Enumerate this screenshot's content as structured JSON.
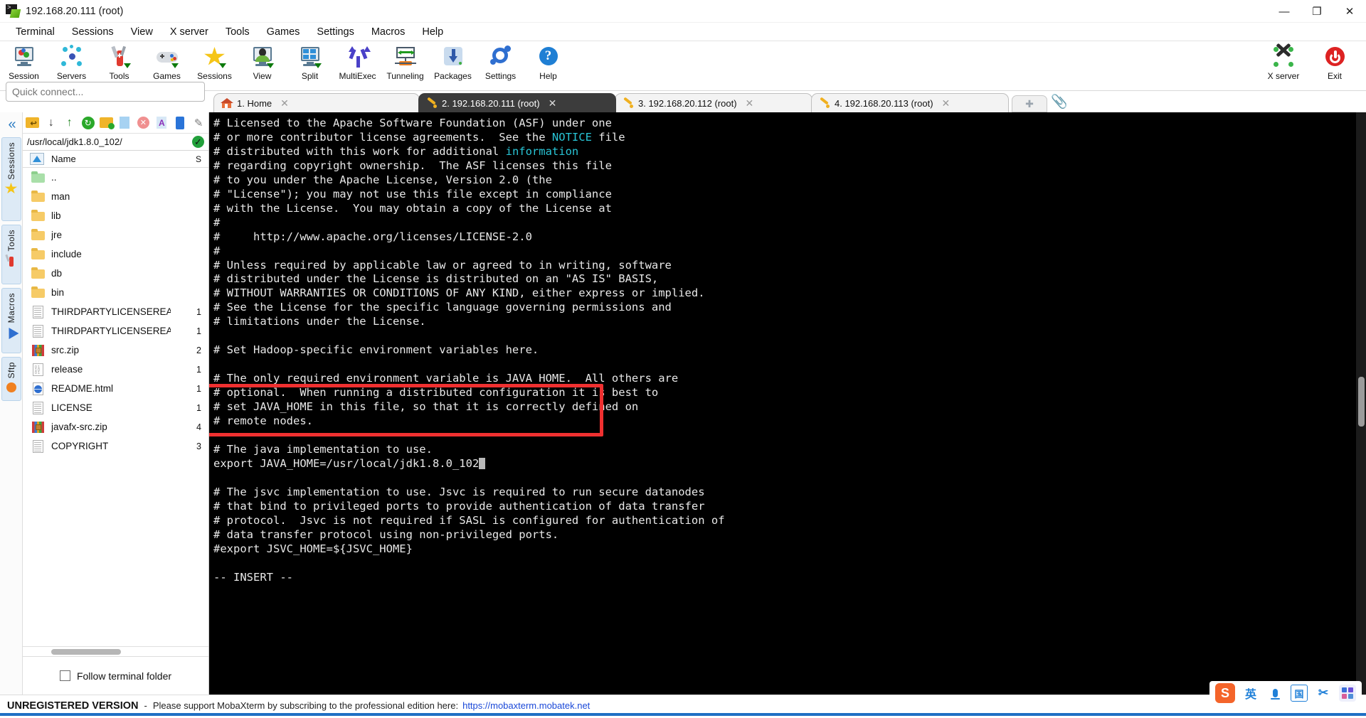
{
  "window": {
    "title": "192.168.20.111 (root)",
    "icon": "mobaxterm-icon",
    "minimize": "—",
    "maximize": "❐",
    "close": "✕"
  },
  "menubar": {
    "items": [
      {
        "label": "Terminal",
        "name": "menu-terminal"
      },
      {
        "label": "Sessions",
        "name": "menu-sessions"
      },
      {
        "label": "View",
        "name": "menu-view"
      },
      {
        "label": "X server",
        "name": "menu-xserver"
      },
      {
        "label": "Tools",
        "name": "menu-tools"
      },
      {
        "label": "Games",
        "name": "menu-games"
      },
      {
        "label": "Settings",
        "name": "menu-settings"
      },
      {
        "label": "Macros",
        "name": "menu-macros"
      },
      {
        "label": "Help",
        "name": "menu-help"
      }
    ]
  },
  "ribbon": {
    "items": [
      {
        "label": "Session",
        "icon": "session-icon"
      },
      {
        "label": "Servers",
        "icon": "servers-icon"
      },
      {
        "label": "Tools",
        "icon": "tools-knife-icon"
      },
      {
        "label": "Games",
        "icon": "gamepad-icon"
      },
      {
        "label": "Sessions",
        "icon": "star-icon"
      },
      {
        "label": "View",
        "icon": "view-user-icon"
      },
      {
        "label": "Split",
        "icon": "split-grid-icon"
      },
      {
        "label": "MultiExec",
        "icon": "multiexec-fork-icon"
      },
      {
        "label": "Tunneling",
        "icon": "tunneling-icon"
      },
      {
        "label": "Packages",
        "icon": "packages-download-icon"
      },
      {
        "label": "Settings",
        "icon": "settings-gear-icon"
      },
      {
        "label": "Help",
        "icon": "help-question-icon"
      }
    ],
    "right": [
      {
        "label": "X server",
        "icon": "x-server-icon"
      },
      {
        "label": "Exit",
        "icon": "exit-power-icon"
      }
    ]
  },
  "quick_connect": {
    "placeholder": "Quick connect...",
    "value": ""
  },
  "tabs": {
    "items": [
      {
        "label": "1. Home",
        "icon": "home-icon",
        "active": false,
        "close": "✕"
      },
      {
        "label": "2. 192.168.20.111 (root)",
        "icon": "ssh-key-icon",
        "active": true,
        "close": "✕"
      },
      {
        "label": "3. 192.168.20.112 (root)",
        "icon": "ssh-key-icon",
        "active": false,
        "close": "✕"
      },
      {
        "label": "4. 192.168.20.113 (root)",
        "icon": "ssh-key-icon",
        "active": false,
        "close": "✕"
      }
    ],
    "new_tab": "✚",
    "clip_icon": "paperclip-icon"
  },
  "rail": {
    "collapse": "«",
    "tabs": [
      {
        "label": "Sessions",
        "icon": "star-icon"
      },
      {
        "label": "Tools",
        "icon": "knife-icon"
      },
      {
        "label": "Macros",
        "icon": "macros-icon"
      },
      {
        "label": "Sftp",
        "icon": "sftp-icon"
      }
    ]
  },
  "sftp": {
    "toolbar": [
      {
        "name": "go-up-folder-icon",
        "glyph": "↑"
      },
      {
        "name": "download-icon",
        "glyph": "↓"
      },
      {
        "name": "upload-icon",
        "glyph": "↑"
      },
      {
        "name": "refresh-icon",
        "glyph": "⟳"
      },
      {
        "name": "new-folder-icon",
        "glyph": "▭"
      },
      {
        "name": "new-file-icon",
        "glyph": "▯"
      },
      {
        "name": "delete-icon",
        "glyph": "✕"
      },
      {
        "name": "text-mode-icon",
        "glyph": "A"
      },
      {
        "name": "binary-mode-icon",
        "glyph": "▯"
      },
      {
        "name": "edit-icon",
        "glyph": "✎"
      }
    ],
    "path": "/usr/local/jdk1.8.0_102/",
    "path_status": "✓",
    "columns": {
      "name": "Name",
      "size": "S"
    },
    "files": [
      {
        "name": "..",
        "size": "",
        "icon": "folder-up-icon"
      },
      {
        "name": "man",
        "size": "",
        "icon": "folder-icon"
      },
      {
        "name": "lib",
        "size": "",
        "icon": "folder-icon"
      },
      {
        "name": "jre",
        "size": "",
        "icon": "folder-icon"
      },
      {
        "name": "include",
        "size": "",
        "icon": "folder-icon"
      },
      {
        "name": "db",
        "size": "",
        "icon": "folder-icon"
      },
      {
        "name": "bin",
        "size": "",
        "icon": "folder-icon"
      },
      {
        "name": "THIRDPARTYLICENSEREAD...",
        "size": "1",
        "icon": "document-icon"
      },
      {
        "name": "THIRDPARTYLICENSEREAD...",
        "size": "1",
        "icon": "document-icon"
      },
      {
        "name": "src.zip",
        "size": "2",
        "icon": "archive-icon"
      },
      {
        "name": "release",
        "size": "1",
        "icon": "textfile-icon"
      },
      {
        "name": "README.html",
        "size": "1",
        "icon": "html-icon"
      },
      {
        "name": "LICENSE",
        "size": "1",
        "icon": "document-icon"
      },
      {
        "name": "javafx-src.zip",
        "size": "4",
        "icon": "archive-icon"
      },
      {
        "name": "COPYRIGHT",
        "size": "3",
        "icon": "document-icon"
      }
    ],
    "follow_label": "Follow terminal folder",
    "follow_checked": false
  },
  "terminal": {
    "lines": [
      "# Licensed to the Apache Software Foundation (ASF) under one",
      "# or more contributor license agreements.  See the NOTICE file",
      "# distributed with this work for additional information",
      "# regarding copyright ownership.  The ASF licenses this file",
      "# to you under the Apache License, Version 2.0 (the",
      "# \"License\"); you may not use this file except in compliance",
      "# with the License.  You may obtain a copy of the License at",
      "#",
      "#     http://www.apache.org/licenses/LICENSE-2.0",
      "#",
      "# Unless required by applicable law or agreed to in writing, software",
      "# distributed under the License is distributed on an \"AS IS\" BASIS,",
      "# WITHOUT WARRANTIES OR CONDITIONS OF ANY KIND, either express or implied.",
      "# See the License for the specific language governing permissions and",
      "# limitations under the License.",
      "",
      "# Set Hadoop-specific environment variables here.",
      "",
      "# The only required environment variable is JAVA_HOME.  All others are",
      "# optional.  When running a distributed configuration it is best to",
      "# set JAVA_HOME in this file, so that it is correctly defined on",
      "# remote nodes.",
      "",
      "# The java implementation to use.",
      "export JAVA_HOME=/usr/local/jdk1.8.0_102",
      "",
      "# The jsvc implementation to use. Jsvc is required to run secure datanodes",
      "# that bind to privileged ports to provide authentication of data transfer",
      "# protocol.  Jsvc is not required if SASL is configured for authentication of",
      "# data transfer protocol using non-privileged ports.",
      "#export JSVC_HOME=${JSVC_HOME}",
      "",
      "-- INSERT --"
    ],
    "highlight_color": "#f03030",
    "cursor": "block"
  },
  "statusbar": {
    "unregistered": "UNREGISTERED VERSION",
    "dash": "-",
    "message": "Please support MobaXterm by subscribing to the professional edition here:",
    "link": "https://mobaxterm.mobatek.net"
  },
  "tray": {
    "items": [
      {
        "name": "sogou-ime-icon",
        "glyph": "S"
      },
      {
        "name": "ime-language-icon",
        "glyph": "英"
      },
      {
        "name": "microphone-icon",
        "glyph": "⬤"
      },
      {
        "name": "ime-handwriting-icon",
        "glyph": "国"
      },
      {
        "name": "scissors-icon",
        "glyph": "✂"
      },
      {
        "name": "apps-grid-icon",
        "glyph": "▦"
      }
    ]
  },
  "colors": {
    "accent": "#1f6fc4",
    "terminal_bg": "#000000",
    "terminal_fg": "#e8e8e8",
    "terminal_cyan": "#29c5d6",
    "highlight_red": "#f03030",
    "link": "#1a48d8"
  }
}
